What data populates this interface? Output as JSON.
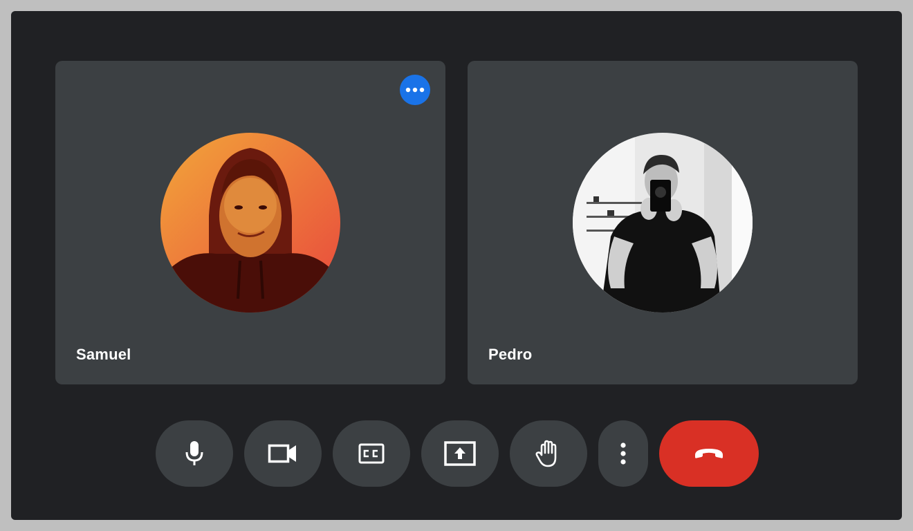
{
  "participants": [
    {
      "name": "Samuel",
      "avatar": "samuel-photo-avatar",
      "tint": [
        "#f2a23a",
        "#e9453d"
      ]
    },
    {
      "name": "Pedro",
      "avatar": "pedro-photo-avatar",
      "tint": [
        "#f0f0f0",
        "#1a1a1a"
      ]
    }
  ],
  "tile_menu": {
    "icon": "more-horizontal-icon",
    "color": "#1a73e8"
  },
  "controls": [
    {
      "name": "microphone",
      "icon": "microphone-icon"
    },
    {
      "name": "camera",
      "icon": "video-camera-icon"
    },
    {
      "name": "captions",
      "icon": "closed-captions-icon"
    },
    {
      "name": "present",
      "icon": "present-screen-icon"
    },
    {
      "name": "raise-hand",
      "icon": "raise-hand-icon"
    },
    {
      "name": "more-options",
      "icon": "more-vertical-icon"
    },
    {
      "name": "leave-call",
      "icon": "hang-up-icon",
      "color": "#d93025"
    }
  ],
  "theme": {
    "background": "#202124",
    "tile": "#3c4043",
    "accent": "#1a73e8",
    "danger": "#d93025"
  }
}
